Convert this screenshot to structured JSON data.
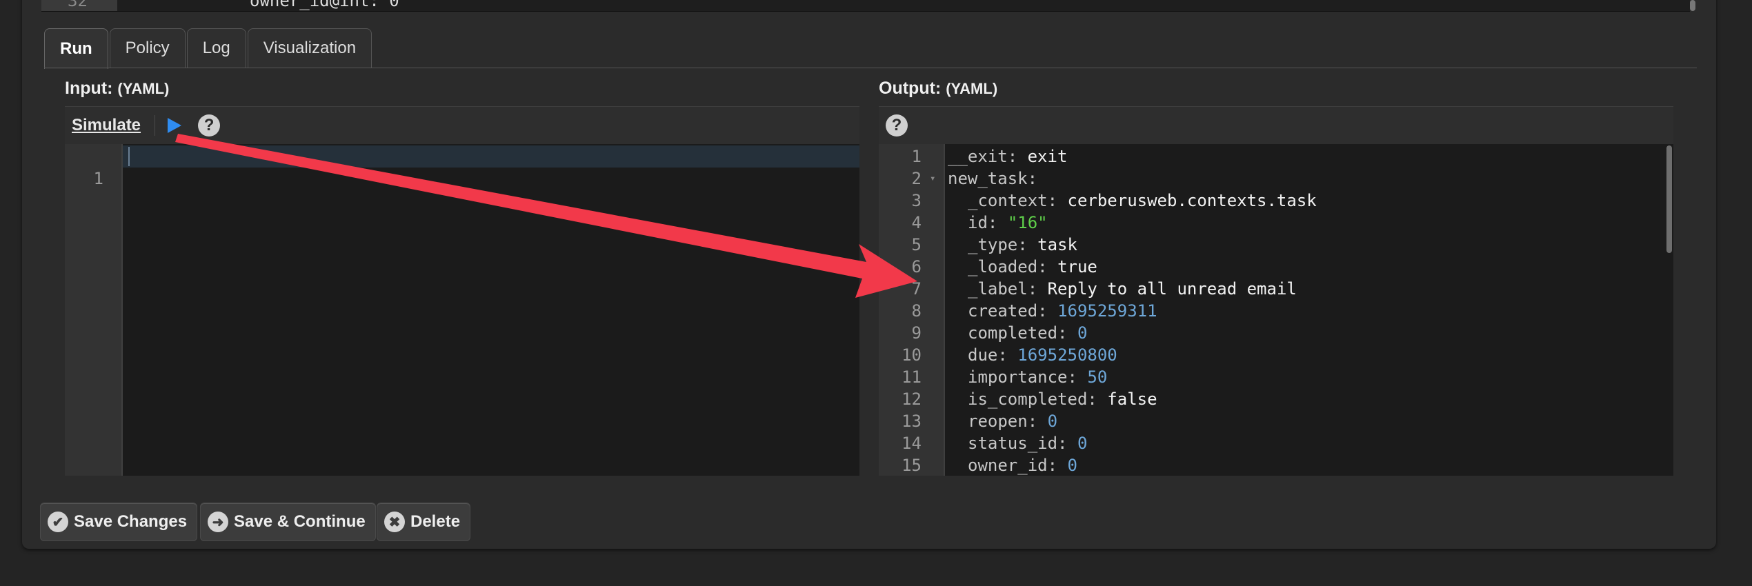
{
  "top_editor": {
    "line_number": "32",
    "code": "owner_id@int: 0"
  },
  "tabs": [
    {
      "label": "Run"
    },
    {
      "label": "Policy"
    },
    {
      "label": "Log"
    },
    {
      "label": "Visualization"
    }
  ],
  "input": {
    "title": "Input:",
    "format": "(YAML)",
    "simulate_label": "Simulate",
    "play_icon": "play-icon",
    "help_icon": "help-icon",
    "line_numbers": [
      "1"
    ]
  },
  "output": {
    "title": "Output:",
    "format": "(YAML)",
    "help_icon": "help-icon",
    "lines": [
      {
        "n": "1",
        "key": "__exit",
        "value": "exit",
        "type": "plain",
        "indent": 0
      },
      {
        "n": "2",
        "key": "new_task",
        "value": "",
        "type": "plain",
        "indent": 0,
        "fold": true
      },
      {
        "n": "3",
        "key": "_context",
        "value": "cerberusweb.contexts.task",
        "type": "plain",
        "indent": 1
      },
      {
        "n": "4",
        "key": "id",
        "value": "\"16\"",
        "type": "str",
        "indent": 1
      },
      {
        "n": "5",
        "key": "_type",
        "value": "task",
        "type": "plain",
        "indent": 1
      },
      {
        "n": "6",
        "key": "_loaded",
        "value": "true",
        "type": "plain",
        "indent": 1
      },
      {
        "n": "7",
        "key": "_label",
        "value": "Reply to all unread email",
        "type": "plain",
        "indent": 1
      },
      {
        "n": "8",
        "key": "created",
        "value": "1695259311",
        "type": "num",
        "indent": 1
      },
      {
        "n": "9",
        "key": "completed",
        "value": "0",
        "type": "num",
        "indent": 1
      },
      {
        "n": "10",
        "key": "due",
        "value": "1695250800",
        "type": "num",
        "indent": 1
      },
      {
        "n": "11",
        "key": "importance",
        "value": "50",
        "type": "num",
        "indent": 1
      },
      {
        "n": "12",
        "key": "is_completed",
        "value": "false",
        "type": "plain",
        "indent": 1
      },
      {
        "n": "13",
        "key": "reopen",
        "value": "0",
        "type": "num",
        "indent": 1
      },
      {
        "n": "14",
        "key": "status_id",
        "value": "0",
        "type": "num",
        "indent": 1
      },
      {
        "n": "15",
        "key": "owner_id",
        "value": "0",
        "type": "num",
        "indent": 1
      }
    ]
  },
  "buttons": [
    {
      "label": "Save Changes",
      "icon": "check-icon",
      "glyph": "✔"
    },
    {
      "label": "Save & Continue",
      "icon": "arrow-right-icon",
      "glyph": "➜"
    },
    {
      "label": "Delete",
      "icon": "close-icon",
      "glyph": "✖"
    }
  ],
  "colors": {
    "play": "#2f8cf0",
    "annotation_arrow": "#f2394a",
    "string": "#5fcf4a",
    "number": "#6ea7d8"
  }
}
